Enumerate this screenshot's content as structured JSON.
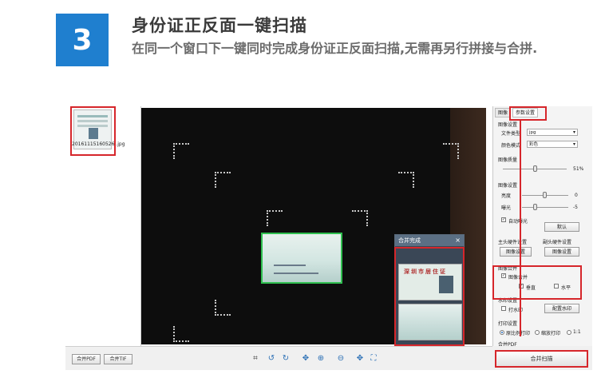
{
  "header": {
    "step_number": "3",
    "title": "身份证正反面一键扫描",
    "description": "在同一个窗口下一键同时完成身份证正反面扫描,无需再另行拼接与合拼."
  },
  "thumbnails": [
    {
      "filename": "20161115160526 .jpg"
    }
  ],
  "popup": {
    "title": "合并完成",
    "close": "×",
    "card_header": "深圳市居住证"
  },
  "settings": {
    "tabs": [
      "图像",
      "参数设置"
    ],
    "image_settings_label": "图像设置",
    "file_type_label": "文件类型",
    "file_type_value": "jpg",
    "color_mode_label": "颜色模式",
    "color_mode_value": "彩色",
    "image_quality_label": "图像质量",
    "image_quality_value": "51%",
    "image_quality_level": 0.51,
    "image_adjust_label": "图像设置",
    "brightness_label": "亮度",
    "brightness_value": "0",
    "exposure_label": "曝光",
    "exposure_value": "-5",
    "auto_exposure_label": "自动曝光",
    "default_button": "默认",
    "main_hw_label": "主头硬件设置",
    "sub_hw_label": "副头硬件设置",
    "image_settings_button_1": "图像设置",
    "image_settings_button_2": "图像设置",
    "image_merge_label": "图像合并",
    "image_merge_check": "图像合并",
    "vertical_label": "垂直",
    "horizontal_label": "水平",
    "watermark_label": "水印设置",
    "watermark_check": "打水印",
    "watermark_button": "配置水印",
    "print_label": "打印设置",
    "print_ratio_label": "原比例打印",
    "print_scale_label": "缩放打印",
    "print_1to1_label": "1:1",
    "merge_pdf_label": "合并PDF"
  },
  "toolbar": {
    "merge_pdf_button": "合并PDF",
    "merge_tif_button": "合并TIF",
    "icons": [
      "crop-icon",
      "rotate-left-icon",
      "rotate-right-icon",
      "fit-icon",
      "zoom-in-icon",
      "zoom-out-icon",
      "move-icon",
      "fullscreen-icon"
    ],
    "merge_scan_button": "合并扫描"
  }
}
